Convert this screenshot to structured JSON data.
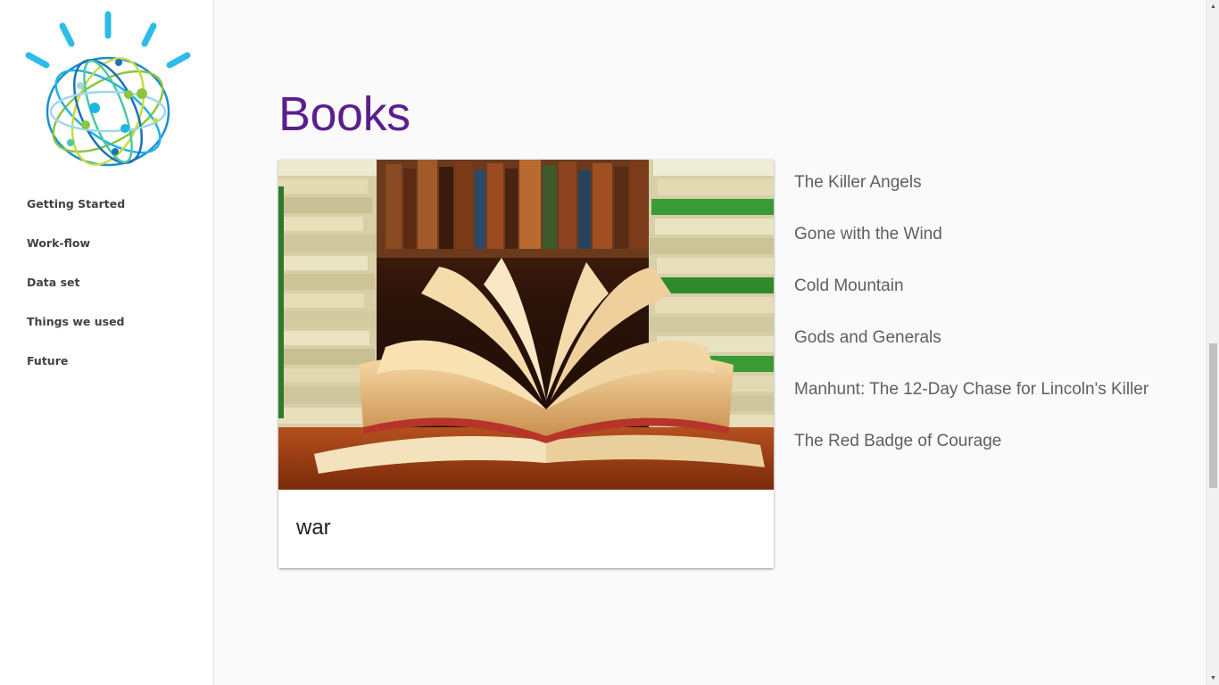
{
  "sidebar": {
    "logo_icon": "watson-globe-logo-icon",
    "items": [
      {
        "label": "Getting Started"
      },
      {
        "label": "Work-flow"
      },
      {
        "label": "Data set"
      },
      {
        "label": "Things we used"
      },
      {
        "label": "Future"
      }
    ]
  },
  "main": {
    "title": "Books",
    "card": {
      "image_icon": "open-books-photo",
      "caption": "war"
    },
    "books": [
      "The Killer Angels",
      "Gone with the Wind",
      "Cold Mountain",
      "Gods and Generals",
      "Manhunt: The 12-Day Chase for Lincoln's Killer",
      "The Red Badge of Courage"
    ]
  },
  "colors": {
    "title": "#5b1f8c",
    "logo_blue": "#1eb4e6",
    "logo_green": "#8cc63f",
    "background": "#fafafa"
  },
  "scrollbar": {
    "position_fraction": 0.5
  }
}
